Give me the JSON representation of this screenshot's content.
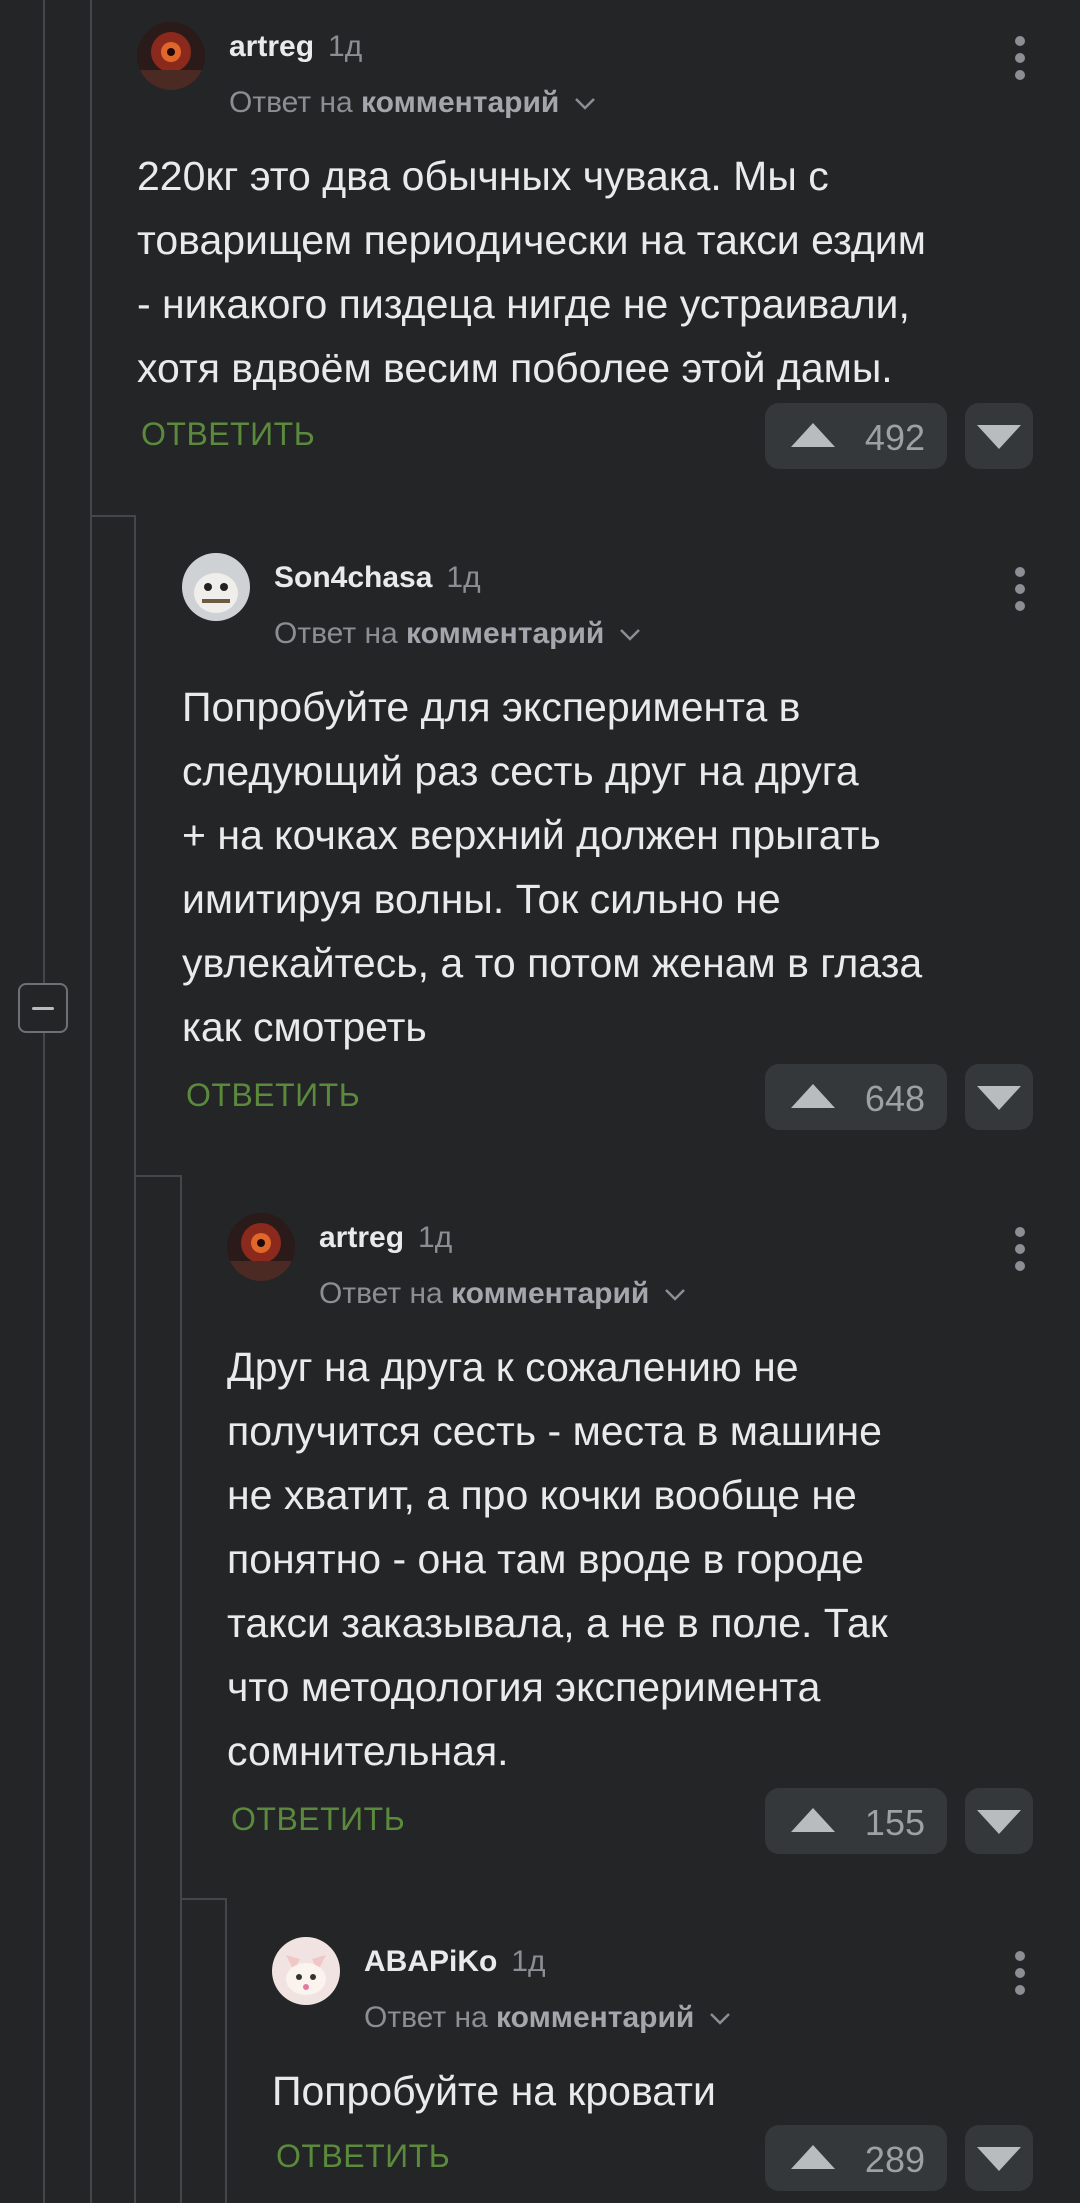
{
  "comments": [
    {
      "username": "artreg",
      "time": "1д",
      "reply_prefix": "Ответ на",
      "reply_target": "комментарий",
      "text": "220кг это два обычных чувака. Мы с\nтоварищем периодически на такси ездим\n- никакого пиздеца нигде не устраивали,\nхотя вдвоём весим поболее этой дамы.",
      "reply_label": "ОТВЕТИТЬ",
      "rating": "492"
    },
    {
      "username": "Son4chasa",
      "time": "1д",
      "reply_prefix": "Ответ на",
      "reply_target": "комментарий",
      "text": "Попробуйте для эксперимента в\nследующий раз сесть друг на друга\n+ на кочках верхний должен прыгать\nимитируя волны. Ток сильно не\nувлекайтесь, а то потом женам в глаза\nкак смотреть",
      "reply_label": "ОТВЕТИТЬ",
      "rating": "648"
    },
    {
      "username": "artreg",
      "time": "1д",
      "reply_prefix": "Ответ на",
      "reply_target": "комментарий",
      "text": "Друг на друга к сожалению не\nполучится сесть - места в машине\nне хватит, а про кочки вообще не\nпонятно - она там вроде в городе\nтакси заказывала, а не в поле. Так\nчто методология эксперимента\nсомнительная.",
      "reply_label": "ОТВЕТИТЬ",
      "rating": "155"
    },
    {
      "username": "ABAPiKo",
      "time": "1д",
      "reply_prefix": "Ответ на",
      "reply_target": "комментарий",
      "text": "Попробуйте на кровати",
      "reply_label": "ОТВЕТИТЬ",
      "rating": "289"
    }
  ]
}
